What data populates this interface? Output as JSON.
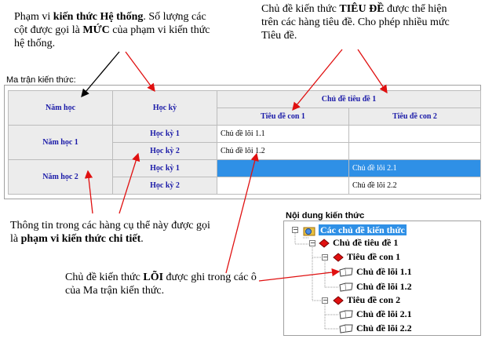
{
  "annotations": {
    "top_left": {
      "pre": "Phạm vi ",
      "bold1": "kiến thức Hệ thống",
      "mid": ". Số lượng các cột được gọi là ",
      "bold2": "MỨC",
      "post": " của phạm vi kiến thức hệ thống."
    },
    "top_right": {
      "pre": "Chủ đề kiến thức ",
      "bold1": "TIÊU ĐỀ",
      "post": " được thể hiện trên các hàng tiêu đề. Cho phép nhiều mức Tiêu đề."
    },
    "bottom_left": {
      "pre": "Thông tin trong các hàng cụ thể này được gọi là ",
      "bold1": "phạm vi kiến thức chi tiết",
      "post": "."
    },
    "bottom_mid": {
      "pre": "Chủ đề kiến thức ",
      "bold1": "LÕI",
      "post": " được ghi trong các ô của Ma trận kiến thức."
    }
  },
  "matrix": {
    "caption": "Ma trận kiến thức:",
    "headers": {
      "nam_hoc": "Năm học",
      "hoc_ky": "Học kỳ",
      "chu_de_tieu_de": "Chủ đề tiêu đề 1",
      "tieu_de_con_1": "Tiêu đề con 1",
      "tieu_de_con_2": "Tiêu đề con 2"
    },
    "rows": {
      "nam_hoc_1": "Năm học 1",
      "nam_hoc_2": "Năm học 2",
      "hk1_a": "Học kỳ 1",
      "hk2_a": "Học kỳ 2",
      "hk1_b": "Học kỳ 1",
      "hk2_b": "Học kỳ 2"
    },
    "cells": {
      "r1c1": "Chủ đề lõi 1.1",
      "r1c2": "",
      "r2c1": "Chủ đề lõi 1.2",
      "r2c2": "",
      "r3c1": "",
      "r3c2": "Chủ đề lõi 2.1",
      "r4c1": "",
      "r4c2": "Chủ đề lõi 2.2"
    },
    "selected_color": "#2f90e6",
    "header_text_color": "#1a1aa8"
  },
  "tree": {
    "caption": "Nội dung kiến thức",
    "root": "Các chủ đề kiến thức",
    "title1": "Chủ đề tiêu đề 1",
    "sub1": "Tiêu đề con 1",
    "core11": "Chủ đề lõi 1.1",
    "core12": "Chủ đề lõi 1.2",
    "sub2": "Tiêu đề con 2",
    "core21": "Chủ đề lõi 2.1",
    "core22": "Chủ đề lõi 2.2",
    "icons": {
      "root": "knowledge-folder-icon",
      "title": "red-diamond-icon",
      "core": "open-book-icon"
    }
  }
}
